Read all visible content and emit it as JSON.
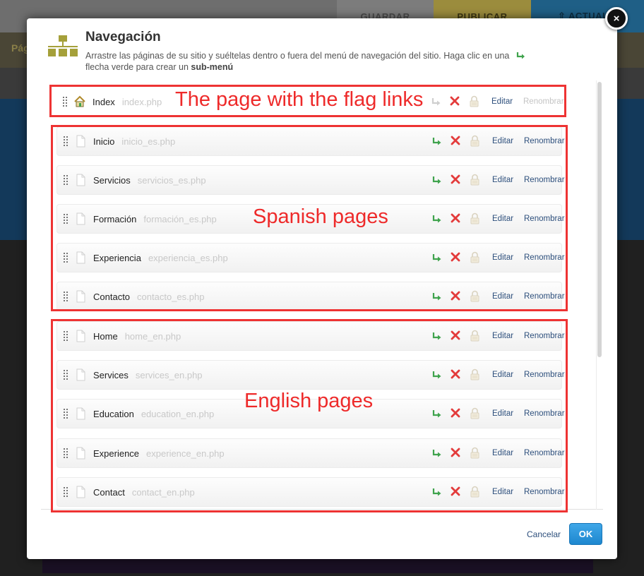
{
  "background": {
    "guardar": "GUARDAR",
    "publicar": "PUBLICAR",
    "actualizar": "⇧ ACTUALIZ",
    "pages_tab": "Pág"
  },
  "modal": {
    "title": "Navegación",
    "description": "Arrastre las páginas de su sitio y suéltelas dentro o fuera del menú de navegación del sitio. Haga clic en una",
    "description_line2": "flecha verde para crear un",
    "description_bold": "sub-menú",
    "close_label": "×",
    "cancel_label": "Cancelar",
    "ok_label": "OK"
  },
  "actions": {
    "edit": "Editar",
    "rename": "Renombrar"
  },
  "pages": [
    {
      "name": "Index",
      "file": "index.php",
      "home": true
    },
    {
      "name": "Inicio",
      "file": "inicio_es.php",
      "home": false
    },
    {
      "name": "Servicios",
      "file": "servicios_es.php",
      "home": false
    },
    {
      "name": "Formación",
      "file": "formación_es.php",
      "home": false
    },
    {
      "name": "Experiencia",
      "file": "experiencia_es.php",
      "home": false
    },
    {
      "name": "Contacto",
      "file": "contacto_es.php",
      "home": false
    },
    {
      "name": "Home",
      "file": "home_en.php",
      "home": false
    },
    {
      "name": "Services",
      "file": "services_en.php",
      "home": false
    },
    {
      "name": "Education",
      "file": "education_en.php",
      "home": false
    },
    {
      "name": "Experience",
      "file": "experience_en.php",
      "home": false
    },
    {
      "name": "Contact",
      "file": "contact_en.php",
      "home": false
    }
  ],
  "annotations": {
    "flag_links": "The page with the flag links",
    "spanish": "Spanish pages",
    "english": "English pages"
  },
  "colors": {
    "annotation_red": "#ee3333",
    "link_blue": "#2d4f7c",
    "ok_blue": "#1e87cf",
    "arrow_green": "#3fa34d",
    "delete_red": "#e33b3b"
  }
}
